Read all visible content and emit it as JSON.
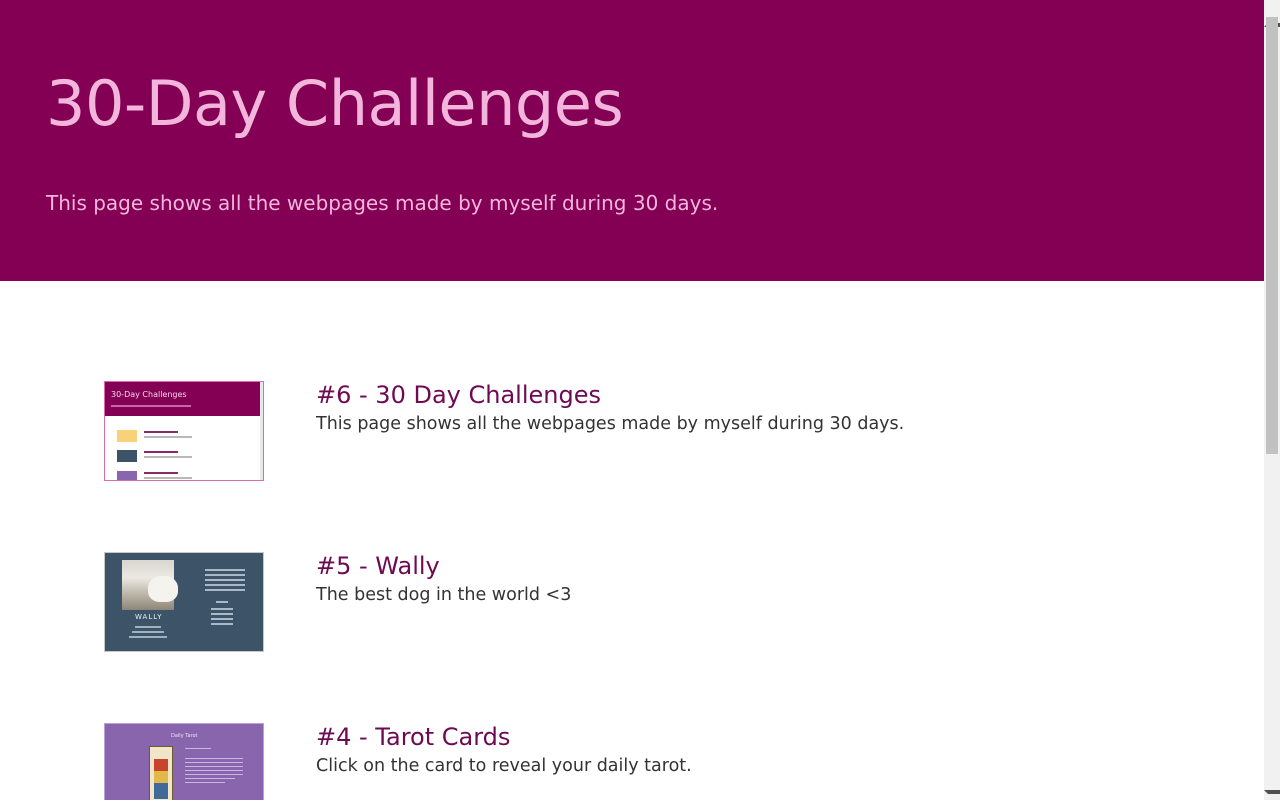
{
  "header": {
    "title": "30-Day Challenges",
    "subtitle": "This page shows all the webpages made by myself during 30 days."
  },
  "projects": [
    {
      "title": "#6 - 30 Day Challenges",
      "description": "This page shows all the webpages made by myself during 30 days.",
      "thumbnail_heading": "30-Day Challenges"
    },
    {
      "title": "#5 - Wally",
      "description": "The best dog in the world <3",
      "thumbnail_heading": "WALLY"
    },
    {
      "title": "#4 - Tarot Cards",
      "description": "Click on the card to reveal your daily tarot.",
      "thumbnail_heading": "Daily Tarot"
    }
  ],
  "colors": {
    "header_background": "#840054",
    "header_text": "#f2b6dc",
    "project_title": "#6e0a52",
    "body_text": "#333333"
  }
}
